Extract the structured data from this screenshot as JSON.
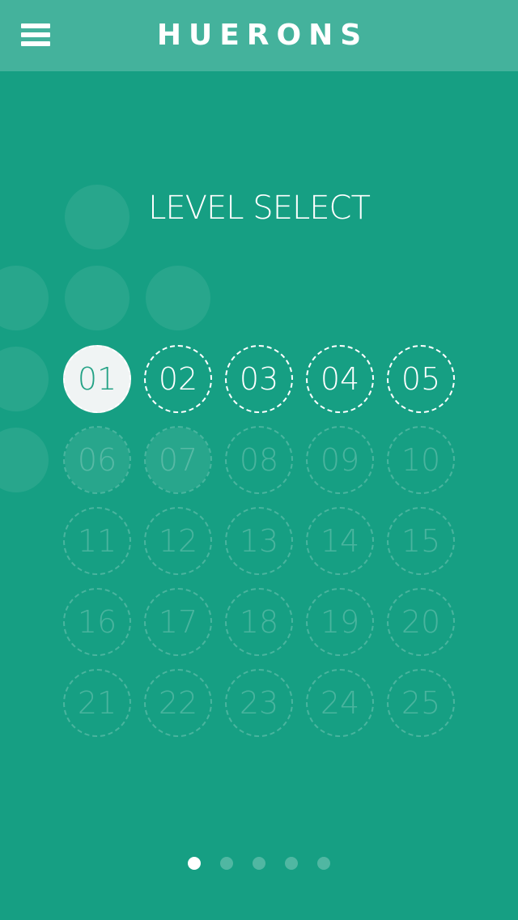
{
  "app": {
    "title": "HUERONS",
    "menu_icon": "hamburger-icon"
  },
  "colors": {
    "background": "#169f83",
    "topbar": "#44b29c",
    "selected_text": "#23a285"
  },
  "page": {
    "heading": "LEVEL SELECT"
  },
  "levels": [
    {
      "label": "01",
      "state": "selected"
    },
    {
      "label": "02",
      "state": "unlocked"
    },
    {
      "label": "03",
      "state": "unlocked"
    },
    {
      "label": "04",
      "state": "unlocked"
    },
    {
      "label": "05",
      "state": "unlocked"
    },
    {
      "label": "06",
      "state": "locked"
    },
    {
      "label": "07",
      "state": "locked"
    },
    {
      "label": "08",
      "state": "locked"
    },
    {
      "label": "09",
      "state": "locked"
    },
    {
      "label": "10",
      "state": "locked"
    },
    {
      "label": "11",
      "state": "locked"
    },
    {
      "label": "12",
      "state": "locked"
    },
    {
      "label": "13",
      "state": "locked"
    },
    {
      "label": "14",
      "state": "locked"
    },
    {
      "label": "15",
      "state": "locked"
    },
    {
      "label": "16",
      "state": "locked"
    },
    {
      "label": "17",
      "state": "locked"
    },
    {
      "label": "18",
      "state": "locked"
    },
    {
      "label": "19",
      "state": "locked"
    },
    {
      "label": "20",
      "state": "locked"
    },
    {
      "label": "21",
      "state": "locked"
    },
    {
      "label": "22",
      "state": "locked"
    },
    {
      "label": "23",
      "state": "locked"
    },
    {
      "label": "24",
      "state": "locked"
    },
    {
      "label": "25",
      "state": "locked"
    }
  ],
  "pager": {
    "total_pages": 5,
    "current_page": 1
  }
}
